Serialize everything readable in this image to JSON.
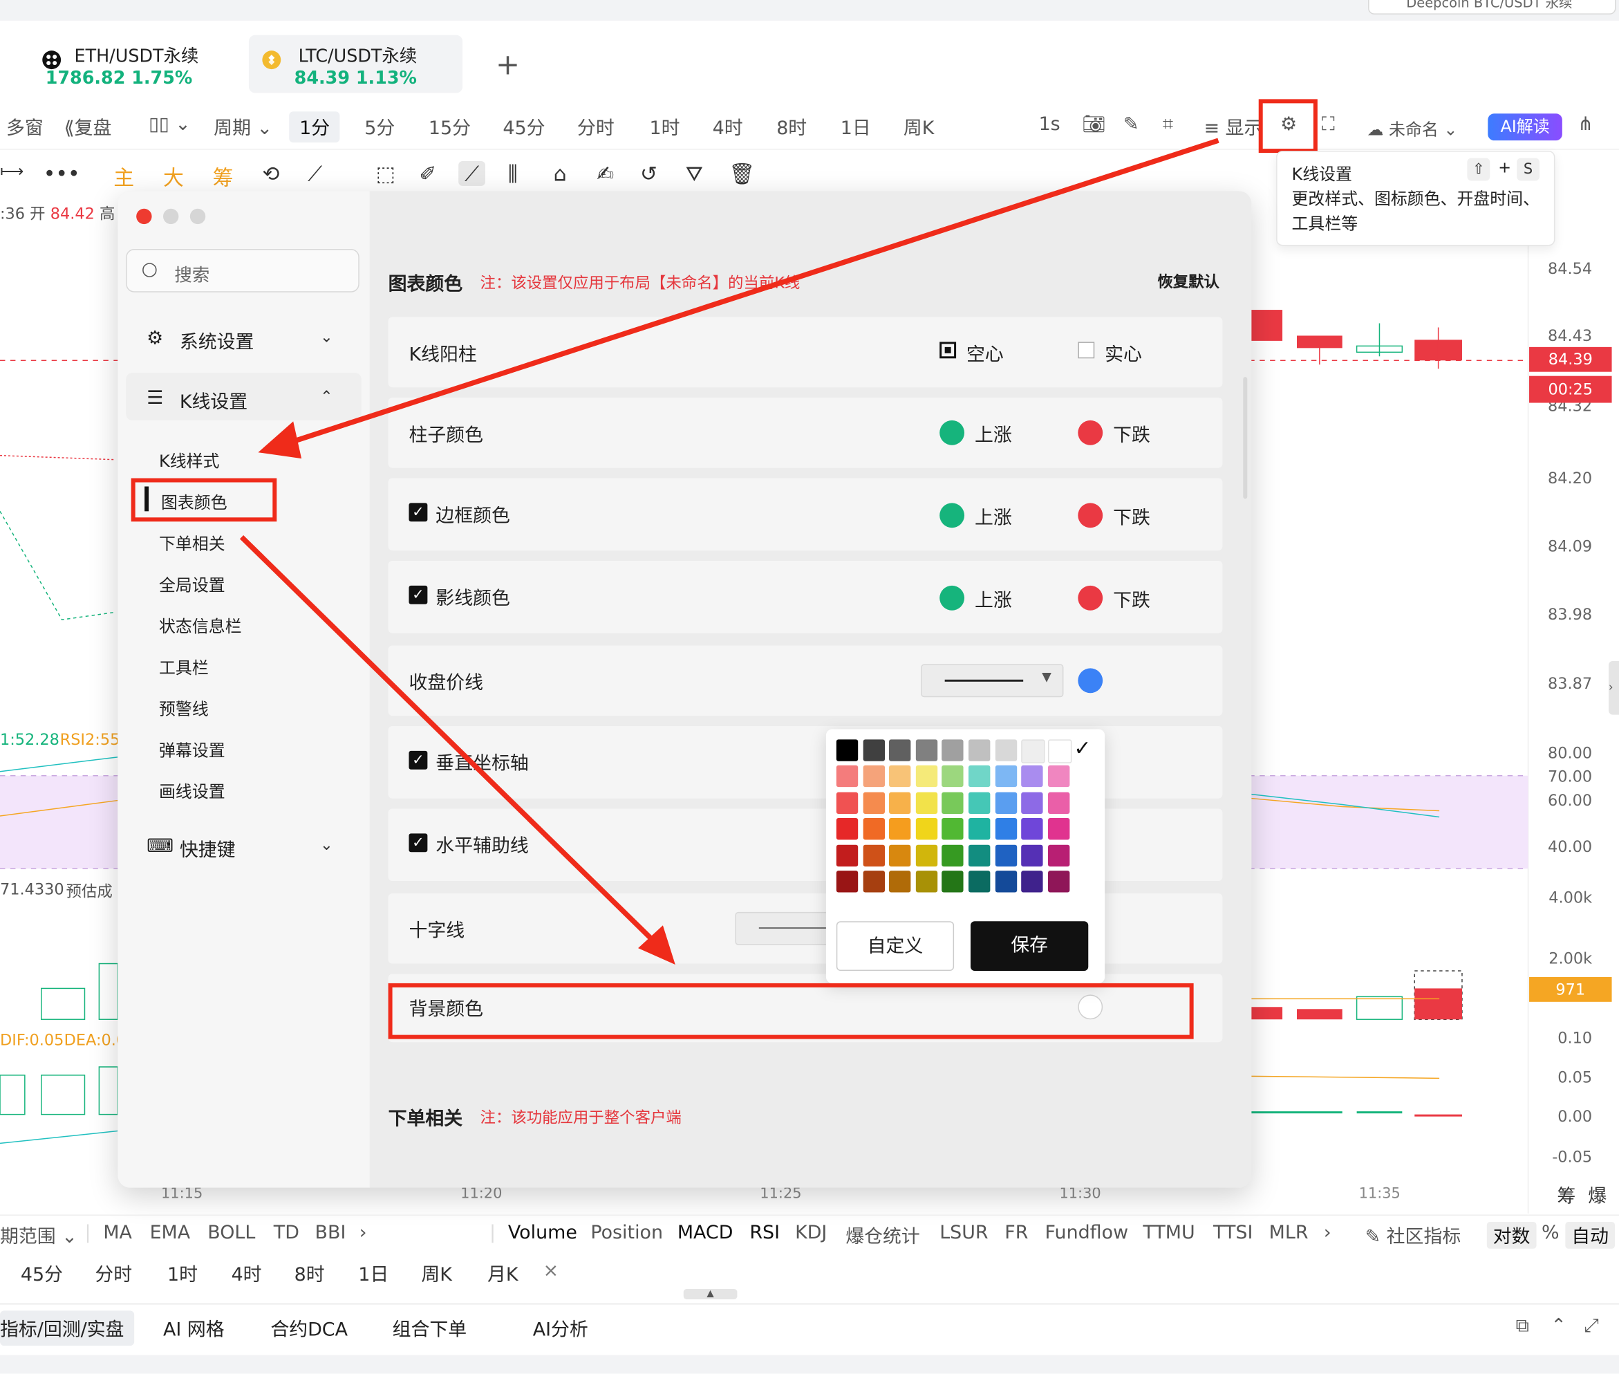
{
  "top": {
    "search_text": "Deepcoin BTC/USDT 永续"
  },
  "tabs": [
    {
      "name": "ETH/USDT永续",
      "price": "1786.82",
      "change": "1.75%"
    },
    {
      "name": "LTC/USDT永续",
      "price": "84.39",
      "change": "1.13%"
    }
  ],
  "toolbar": {
    "multi_window": "多窗",
    "replay": "复盘",
    "period": "周期",
    "intervals": [
      "1分",
      "5分",
      "15分",
      "45分",
      "分时",
      "1时",
      "4时",
      "8时",
      "1日",
      "周K"
    ],
    "seconds": "1s",
    "display": "显示",
    "layout_name": "未命名",
    "ai_button": "AI解读"
  },
  "toolbar2": {
    "main": "主",
    "big": "大",
    "chip": "筹"
  },
  "tooltip": {
    "title": "K线设置",
    "shortcut_1": "⇧",
    "shortcut_plus": "+",
    "shortcut_2": "S",
    "description": "更改样式、图标颜色、开盘时间、工具栏等"
  },
  "chart": {
    "ohlc_prefix": ":36 开",
    "open_value": "84.42",
    "high_prefix": "高",
    "rsi_text": "1:52.28",
    "rsi2_text": "RSI2:55",
    "vol_text": "71.4330",
    "vol_label": "预估成",
    "macd_dif": "DIF:0.05",
    "macd_dea": "DEA:0.0",
    "price_axis": [
      "84.54",
      "84.43",
      "84.32",
      "84.20",
      "84.09",
      "83.98",
      "83.87"
    ],
    "current_price": "84.39",
    "countdown": "00:25",
    "rsi_axis": [
      "80.00",
      "70.00",
      "60.00",
      "40.00"
    ],
    "vol_axis": [
      "4.00k",
      "2.00k"
    ],
    "vol_current": "971",
    "macd_axis": [
      "0.10",
      "0.05",
      "0.00",
      "-0.05"
    ],
    "x_axis": [
      "11:15",
      "11:20",
      "11:25",
      "11:30",
      "11:35"
    ],
    "corner_chip": "筹",
    "corner_burst": "爆",
    "colors": {
      "up": "#16b47c",
      "down": "#ea3943",
      "current_tag": "#ea3943",
      "vol_tag": "#f5a623"
    }
  },
  "dialog": {
    "search_placeholder": "搜索",
    "sections": {
      "system": "系统设置",
      "kline": "K线设置",
      "shortcuts": "快捷键"
    },
    "kline_items": [
      "K线样式",
      "图表颜色",
      "下单相关",
      "全局设置",
      "状态信息栏",
      "工具栏",
      "预警线",
      "弹幕设置",
      "画线设置"
    ],
    "main": {
      "heading": "图表颜色",
      "note": "注：该设置仅应用于布局【未命名】的当前K线",
      "restore": "恢复默认",
      "rows": {
        "kline_up_bar": {
          "label": "K线阳柱",
          "opt1": "空心",
          "opt2": "实心"
        },
        "bar_color": {
          "label": "柱子颜色",
          "up": "上涨",
          "down": "下跌"
        },
        "border_color": {
          "label": "边框颜色",
          "up": "上涨",
          "down": "下跌"
        },
        "wick_color": {
          "label": "影线颜色",
          "up": "上涨",
          "down": "下跌"
        },
        "close_line": {
          "label": "收盘价线"
        },
        "vertical_axis": {
          "label": "垂直坐标轴"
        },
        "horizontal_grid": {
          "label": "水平辅助线"
        },
        "crosshair": {
          "label": "十字线"
        },
        "background": {
          "label": "背景颜色"
        }
      },
      "palette": {
        "custom": "自定义",
        "save": "保存"
      },
      "order_heading": "下单相关",
      "order_note": "注：该功能应用于整个客户端"
    }
  },
  "indicators": {
    "range": "期范围",
    "main": [
      "MA",
      "EMA",
      "BOLL",
      "TD",
      "BBI"
    ],
    "sub": [
      "Volume",
      "Position",
      "MACD",
      "RSI",
      "KDJ",
      "爆仓统计",
      "LSUR",
      "FR",
      "Fundflow",
      "TTMU",
      "TTSI",
      "MLR"
    ],
    "community": "社区指标",
    "log": "对数",
    "percent": "%",
    "auto": "自动"
  },
  "timebar": [
    "45分",
    "分时",
    "1时",
    "4时",
    "8时",
    "1日",
    "周K",
    "月K"
  ],
  "bottom": [
    "指标/回测/实盘",
    "AI 网格",
    "合约DCA",
    "组合下单",
    "AI分析"
  ]
}
